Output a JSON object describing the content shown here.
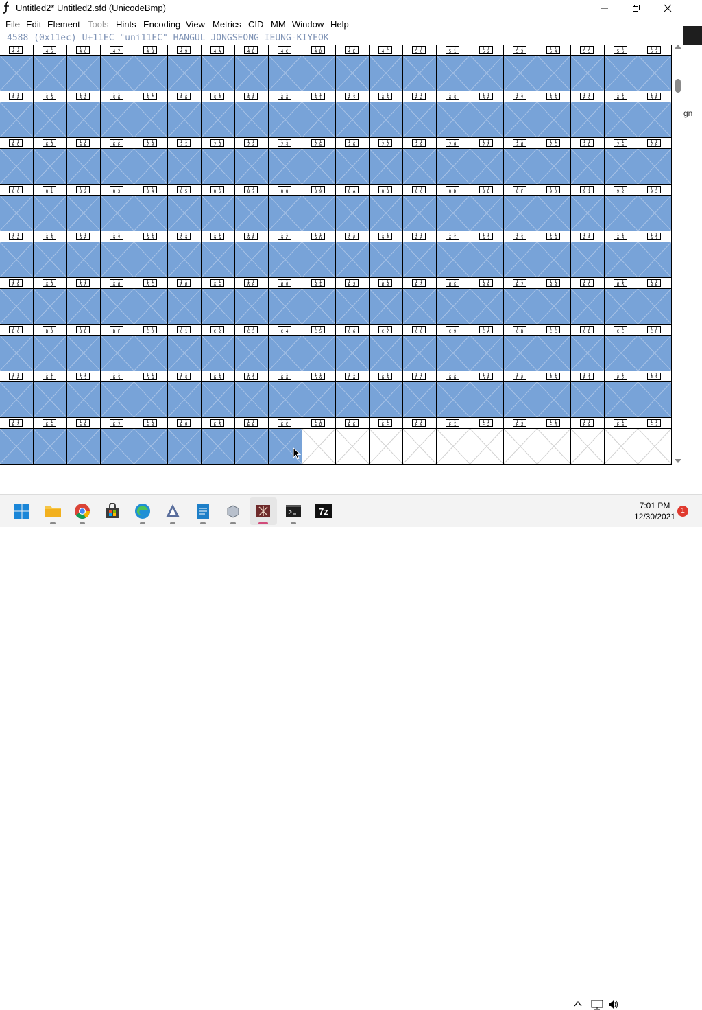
{
  "window": {
    "title": "Untitled2*  Untitled2.sfd (UnicodeBmp)",
    "minimize_label": "—",
    "maximize_label": "❐",
    "close_label": "✕"
  },
  "menu": [
    {
      "label": "File",
      "enabled": true
    },
    {
      "label": "Edit",
      "enabled": true
    },
    {
      "label": "Element",
      "enabled": true
    },
    {
      "label": "Tools",
      "enabled": false
    },
    {
      "label": "Hints",
      "enabled": true
    },
    {
      "label": "Encoding",
      "enabled": true
    },
    {
      "label": "View",
      "enabled": true
    },
    {
      "label": "Metrics",
      "enabled": true
    },
    {
      "label": "CID",
      "enabled": true
    },
    {
      "label": "MM",
      "enabled": true
    },
    {
      "label": "Window",
      "enabled": true
    },
    {
      "label": "Help",
      "enabled": true
    }
  ],
  "glyph_info": "4588 (0x11ec) U+11EC \"uni11EC\" HANGUL JONGSEONG IEUNG-KIYEOK",
  "grid": {
    "columns": 20,
    "rows": 9,
    "labels": [
      "44",
      "45",
      "46",
      "47",
      "48",
      "49",
      "4A",
      "4B",
      "4C",
      "4D",
      "4E",
      "4F",
      "50",
      "51",
      "52",
      "53",
      "54",
      "55",
      "56",
      "57",
      "58",
      "59",
      "5A",
      "5B",
      "5C",
      "5D",
      "5E",
      "5F",
      "60",
      "61",
      "62",
      "63",
      "64",
      "65",
      "66",
      "67",
      "68",
      "69",
      "6A",
      "6B",
      "6C",
      "6D",
      "6E",
      "6F",
      "70",
      "71",
      "72",
      "73",
      "74",
      "75",
      "76",
      "77",
      "78",
      "79",
      "7A",
      "7B",
      "7C",
      "7D",
      "7E",
      "7F",
      "80",
      "81",
      "82",
      "83",
      "84",
      "85",
      "86",
      "87",
      "88",
      "89",
      "8A",
      "8B",
      "8C",
      "8D",
      "8E",
      "8F",
      "90",
      "91",
      "92",
      "93",
      "94",
      "95",
      "96",
      "97",
      "98",
      "99",
      "9A",
      "9B",
      "9C",
      "9D",
      "9E",
      "9F",
      "A0",
      "A1",
      "A2",
      "A3",
      "A4",
      "A5",
      "A6",
      "A7",
      "A8",
      "A9",
      "AA",
      "AB",
      "AC",
      "AD",
      "AE",
      "AF",
      "B0",
      "B1",
      "B2",
      "B3",
      "B4",
      "B5",
      "B6",
      "B7",
      "B8",
      "B9",
      "BA",
      "BB",
      "BC",
      "BD",
      "BE",
      "BF",
      "C0",
      "C1",
      "C2",
      "C3",
      "C4",
      "C5",
      "C6",
      "C7",
      "C8",
      "C9",
      "CA",
      "CB",
      "CC",
      "CD",
      "CE",
      "CF",
      "D0",
      "D1",
      "D2",
      "D3",
      "D4",
      "D5",
      "D6",
      "D7",
      "D8",
      "D9",
      "DA",
      "DB",
      "DC",
      "DD",
      "DE",
      "DF",
      "E0",
      "E1",
      "E2",
      "E3",
      "E4",
      "E5",
      "E6",
      "E7",
      "E8",
      "E9",
      "EA",
      "EB",
      "EC",
      "ED",
      "EE",
      "EF",
      "F0",
      "F1",
      "F2",
      "F3",
      "F4",
      "F5",
      "F6",
      "F7"
    ],
    "filled_count": 169,
    "fill_color": "#78a3d8",
    "empty_color": "#ffffff",
    "info_color": "#7f93b5"
  },
  "taskbar": {
    "apps": [
      {
        "name": "start-button"
      },
      {
        "name": "file-explorer"
      },
      {
        "name": "chrome"
      },
      {
        "name": "microsoft-store"
      },
      {
        "name": "edge"
      },
      {
        "name": "inkscape"
      },
      {
        "name": "notepad"
      },
      {
        "name": "cloud-app"
      },
      {
        "name": "fontforge",
        "active": true
      },
      {
        "name": "terminal"
      },
      {
        "name": "7zip"
      }
    ],
    "time": "7:01 PM",
    "date": "12/30/2021",
    "notification_count": "1",
    "sevenzip_label": "7z"
  },
  "right_strip_text": "gn"
}
